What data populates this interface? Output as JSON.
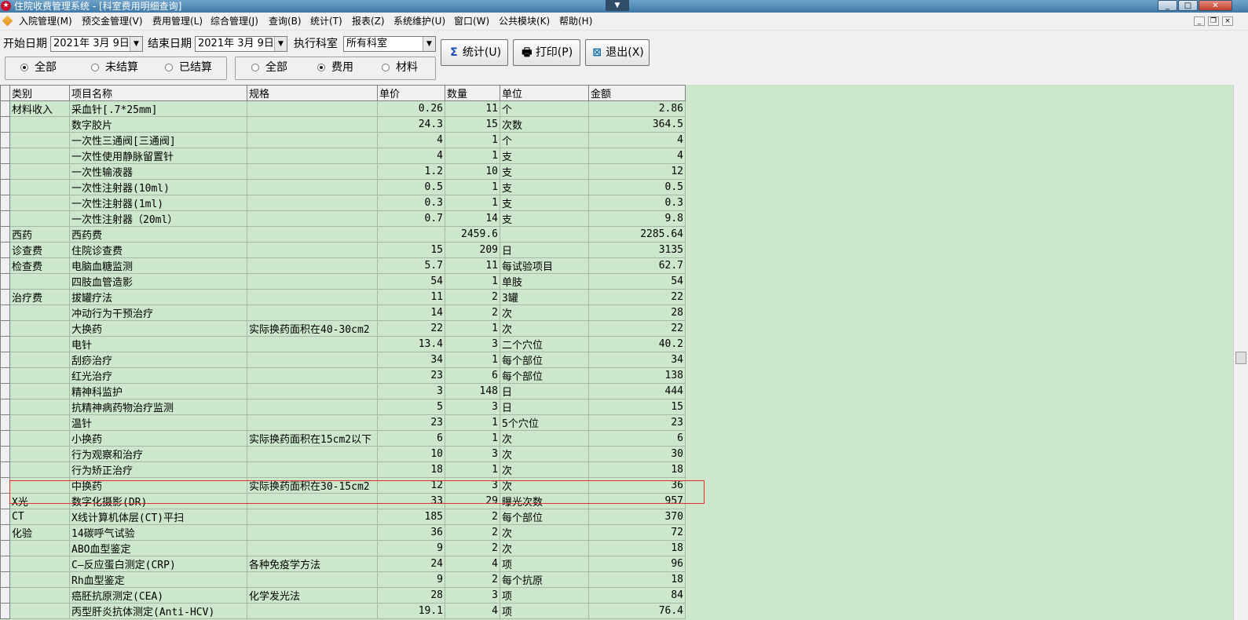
{
  "window": {
    "title": "住院收费管理系统 - [科室费用明细查询]",
    "dropdown_glyph": "▼"
  },
  "menu": [
    "入院管理(M)",
    "预交金管理(V)",
    "费用管理(L)",
    "综合管理(J)",
    "查询(B)",
    "统计(T)",
    "报表(Z)",
    "系统维护(U)",
    "窗口(W)",
    "公共模块(K)",
    "帮助(H)"
  ],
  "toolbar": {
    "start_label": "开始日期",
    "start_value": "2021年 3月 9日",
    "end_label": "结束日期",
    "end_value": "2021年 3月 9日",
    "dept_label": "执行科室",
    "dept_value": "所有科室",
    "stat_button": "统计(U)",
    "print_button": "打印(P)",
    "exit_button": "退出(X)"
  },
  "filters": {
    "settle": [
      "全部",
      "未结算",
      "已结算"
    ],
    "settle_selected": 0,
    "kind": [
      "全部",
      "费用",
      "材料"
    ],
    "kind_selected": 1
  },
  "grid": {
    "columns": [
      "类别",
      "项目名称",
      "规格",
      "单价",
      "数量",
      "单位",
      "金额"
    ],
    "rows": [
      [
        "材料收入",
        "采血针[.7*25mm]",
        "",
        "0.26",
        "11",
        "个",
        "2.86"
      ],
      [
        "",
        "数字胶片",
        "",
        "24.3",
        "15",
        "次数",
        "364.5"
      ],
      [
        "",
        "一次性三通阀[三通阀]",
        "",
        "4",
        "1",
        "个",
        "4"
      ],
      [
        "",
        "一次性使用静脉留置针",
        "",
        "4",
        "1",
        "支",
        "4"
      ],
      [
        "",
        "一次性输液器",
        "",
        "1.2",
        "10",
        "支",
        "12"
      ],
      [
        "",
        "一次性注射器(10ml)",
        "",
        "0.5",
        "1",
        "支",
        "0.5"
      ],
      [
        "",
        "一次性注射器(1ml)",
        "",
        "0.3",
        "1",
        "支",
        "0.3"
      ],
      [
        "",
        "一次性注射器（20ml）",
        "",
        "0.7",
        "14",
        "支",
        "9.8"
      ],
      [
        "西药",
        "西药费",
        "",
        "",
        "2459.6",
        "",
        "2285.64"
      ],
      [
        "诊查费",
        "住院诊查费",
        "",
        "15",
        "209",
        "日",
        "3135"
      ],
      [
        "检查费",
        "电脑血糖监测",
        "",
        "5.7",
        "11",
        "每试验项目",
        "62.7"
      ],
      [
        "",
        "四肢血管造影",
        "",
        "54",
        "1",
        "单肢",
        "54"
      ],
      [
        "治疗费",
        "拔罐疗法",
        "",
        "11",
        "2",
        "3罐",
        "22"
      ],
      [
        "",
        "冲动行为干预治疗",
        "",
        "14",
        "2",
        "次",
        "28"
      ],
      [
        "",
        "大换药",
        "实际换药面积在40-30cm2",
        "22",
        "1",
        "次",
        "22"
      ],
      [
        "",
        "电针",
        "",
        "13.4",
        "3",
        "二个穴位",
        "40.2"
      ],
      [
        "",
        "刮痧治疗",
        "",
        "34",
        "1",
        "每个部位",
        "34"
      ],
      [
        "",
        "红光治疗",
        "",
        "23",
        "6",
        "每个部位",
        "138"
      ],
      [
        "",
        "精神科监护",
        "",
        "3",
        "148",
        "日",
        "444"
      ],
      [
        "",
        "抗精神病药物治疗监测",
        "",
        "5",
        "3",
        "日",
        "15"
      ],
      [
        "",
        "温针",
        "",
        "23",
        "1",
        "5个穴位",
        "23"
      ],
      [
        "",
        "小换药",
        "实际换药面积在15cm2以下",
        "6",
        "1",
        "次",
        "6"
      ],
      [
        "",
        "行为观察和治疗",
        "",
        "10",
        "3",
        "次",
        "30"
      ],
      [
        "",
        "行为矫正治疗",
        "",
        "18",
        "1",
        "次",
        "18"
      ],
      [
        "",
        "中换药",
        "实际换药面积在30-15cm2",
        "12",
        "3",
        "次",
        "36"
      ],
      [
        "X光",
        "数字化摄影(DR)",
        "",
        "33",
        "29",
        "曝光次数",
        "957"
      ],
      [
        "CT",
        "X线计算机体层(CT)平扫",
        "",
        "185",
        "2",
        "每个部位",
        "370"
      ],
      [
        "化验",
        "14碳呼气试验",
        "",
        "36",
        "2",
        "次",
        "72"
      ],
      [
        "",
        "ABO血型鉴定",
        "",
        "9",
        "2",
        "次",
        "18"
      ],
      [
        "",
        "C—反应蛋白测定(CRP)",
        "各种免疫学方法",
        "24",
        "4",
        "项",
        "96"
      ],
      [
        "",
        "Rh血型鉴定",
        "",
        "9",
        "2",
        "每个抗原",
        "18"
      ],
      [
        "",
        "癌胚抗原测定(CEA)",
        "化学发光法",
        "28",
        "3",
        "项",
        "84"
      ],
      [
        "",
        "丙型肝炎抗体测定(Anti-HCV)",
        "",
        "19.1",
        "4",
        "项",
        "76.4"
      ]
    ]
  },
  "colors": {
    "grid_background": "#cce7cc",
    "highlight_border": "#e0302a"
  }
}
